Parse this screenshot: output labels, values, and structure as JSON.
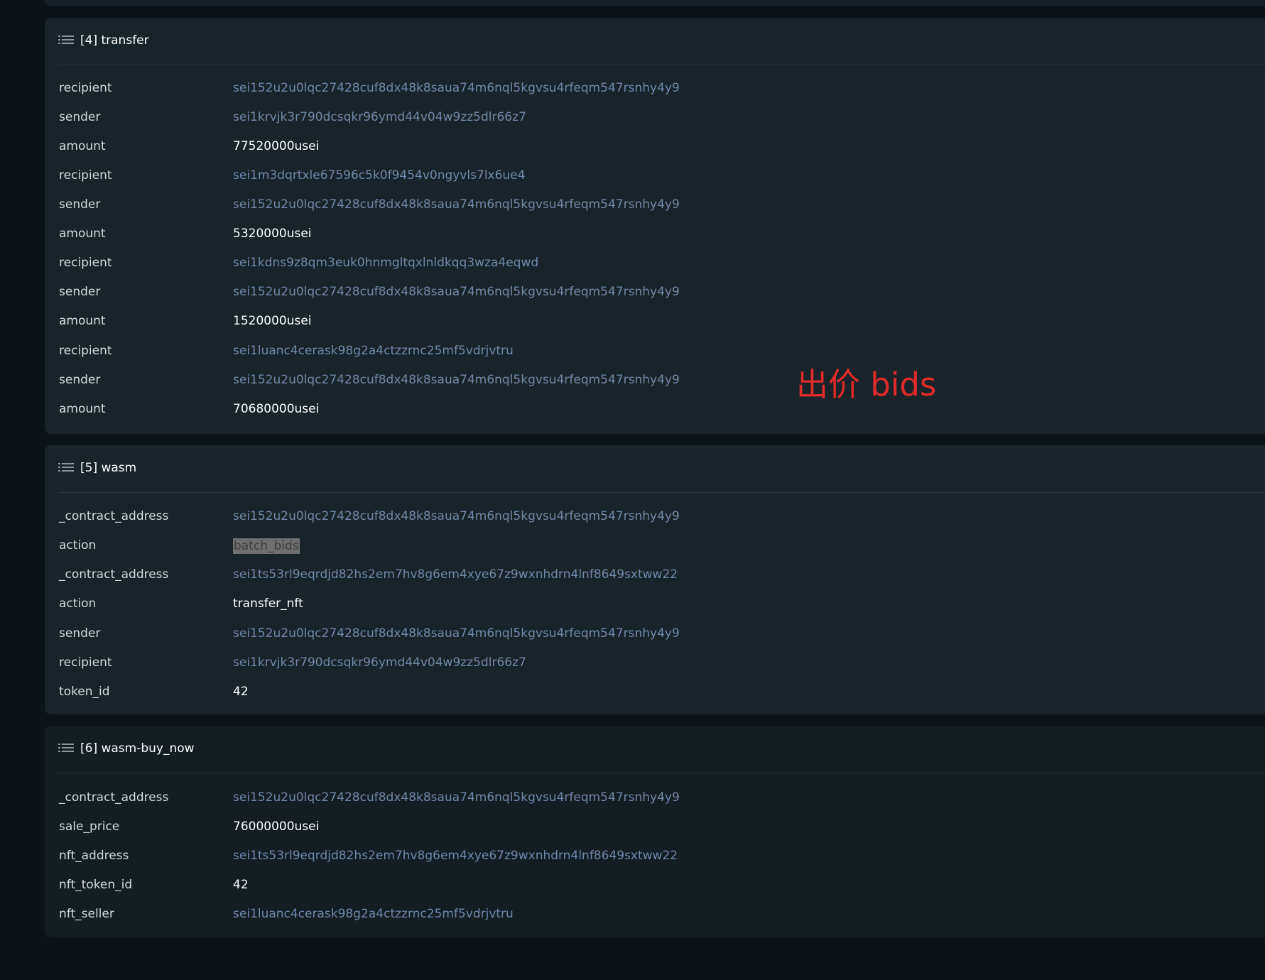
{
  "sections": [
    {
      "title": "[4] transfer",
      "rows": [
        {
          "key": "recipient",
          "value": "sei152u2u0lqc27428cuf8dx48k8saua74m6nql5kgvsu4rfeqm547rsnhy4y9"
        },
        {
          "key": "sender",
          "value": "sei1krvjk3r790dcsqkr96ymd44v04w9zz5dlr66z7"
        },
        {
          "key": "amount",
          "value": "77520000usei"
        },
        {
          "key": "recipient",
          "value": "sei1m3dqrtxle67596c5k0f9454v0ngyvls7lx6ue4"
        },
        {
          "key": "sender",
          "value": "sei152u2u0lqc27428cuf8dx48k8saua74m6nql5kgvsu4rfeqm547rsnhy4y9"
        },
        {
          "key": "amount",
          "value": "5320000usei"
        },
        {
          "key": "recipient",
          "value": "sei1kdns9z8qm3euk0hnmgltqxlnldkqq3wza4eqwd"
        },
        {
          "key": "sender",
          "value": "sei152u2u0lqc27428cuf8dx48k8saua74m6nql5kgvsu4rfeqm547rsnhy4y9"
        },
        {
          "key": "amount",
          "value": "1520000usei"
        },
        {
          "key": "recipient",
          "value": "sei1luanc4cerask98g2a4ctzzrnc25mf5vdrjvtru"
        },
        {
          "key": "sender",
          "value": "sei152u2u0lqc27428cuf8dx48k8saua74m6nql5kgvsu4rfeqm547rsnhy4y9"
        },
        {
          "key": "amount",
          "value": "70680000usei"
        }
      ]
    },
    {
      "title": "[5] wasm",
      "rows": [
        {
          "key": "_contract_address",
          "value": "sei152u2u0lqc27428cuf8dx48k8saua74m6nql5kgvsu4rfeqm547rsnhy4y9"
        },
        {
          "key": "action",
          "value": "batch_bids"
        },
        {
          "key": "_contract_address",
          "value": "sei1ts53rl9eqrdjd82hs2em7hv8g6em4xye67z9wxnhdrn4lnf8649sxtww22"
        },
        {
          "key": "action",
          "value": "transfer_nft"
        },
        {
          "key": "sender",
          "value": "sei152u2u0lqc27428cuf8dx48k8saua74m6nql5kgvsu4rfeqm547rsnhy4y9"
        },
        {
          "key": "recipient",
          "value": "sei1krvjk3r790dcsqkr96ymd44v04w9zz5dlr66z7"
        },
        {
          "key": "token_id",
          "value": "42"
        }
      ]
    },
    {
      "title": "[6] wasm-buy_now",
      "rows": [
        {
          "key": "_contract_address",
          "value": "sei152u2u0lqc27428cuf8dx48k8saua74m6nql5kgvsu4rfeqm547rsnhy4y9"
        },
        {
          "key": "sale_price",
          "value": "76000000usei"
        },
        {
          "key": "nft_address",
          "value": "sei1ts53rl9eqrdjd82hs2em7hv8g6em4xye67z9wxnhdrn4lnf8649sxtww22"
        },
        {
          "key": "nft_token_id",
          "value": "42"
        },
        {
          "key": "nft_seller",
          "value": "sei1luanc4cerask98g2a4ctzzrnc25mf5vdrjvtru"
        }
      ]
    }
  ],
  "annotation": "出价 bids",
  "colors": {
    "link": "#6f88ac",
    "annotation": "#e12a2a",
    "highlight": "#6f6f6f"
  }
}
